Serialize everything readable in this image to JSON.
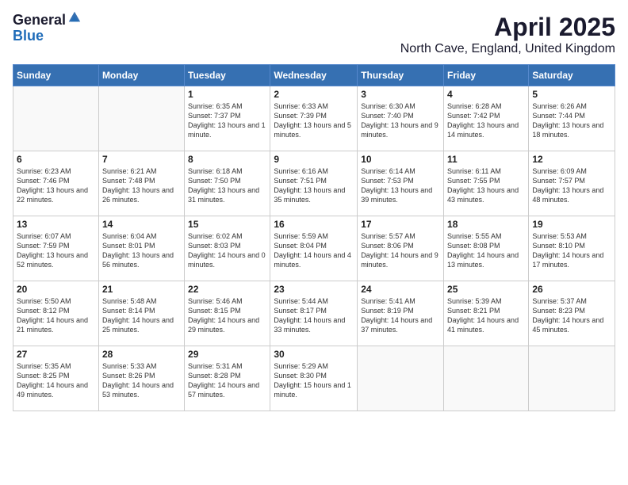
{
  "header": {
    "logo_general": "General",
    "logo_blue": "Blue",
    "title": "April 2025",
    "subtitle": "North Cave, England, United Kingdom"
  },
  "columns": [
    "Sunday",
    "Monday",
    "Tuesday",
    "Wednesday",
    "Thursday",
    "Friday",
    "Saturday"
  ],
  "weeks": [
    [
      {
        "day": "",
        "info": ""
      },
      {
        "day": "",
        "info": ""
      },
      {
        "day": "1",
        "info": "Sunrise: 6:35 AM\nSunset: 7:37 PM\nDaylight: 13 hours and 1 minute."
      },
      {
        "day": "2",
        "info": "Sunrise: 6:33 AM\nSunset: 7:39 PM\nDaylight: 13 hours and 5 minutes."
      },
      {
        "day": "3",
        "info": "Sunrise: 6:30 AM\nSunset: 7:40 PM\nDaylight: 13 hours and 9 minutes."
      },
      {
        "day": "4",
        "info": "Sunrise: 6:28 AM\nSunset: 7:42 PM\nDaylight: 13 hours and 14 minutes."
      },
      {
        "day": "5",
        "info": "Sunrise: 6:26 AM\nSunset: 7:44 PM\nDaylight: 13 hours and 18 minutes."
      }
    ],
    [
      {
        "day": "6",
        "info": "Sunrise: 6:23 AM\nSunset: 7:46 PM\nDaylight: 13 hours and 22 minutes."
      },
      {
        "day": "7",
        "info": "Sunrise: 6:21 AM\nSunset: 7:48 PM\nDaylight: 13 hours and 26 minutes."
      },
      {
        "day": "8",
        "info": "Sunrise: 6:18 AM\nSunset: 7:50 PM\nDaylight: 13 hours and 31 minutes."
      },
      {
        "day": "9",
        "info": "Sunrise: 6:16 AM\nSunset: 7:51 PM\nDaylight: 13 hours and 35 minutes."
      },
      {
        "day": "10",
        "info": "Sunrise: 6:14 AM\nSunset: 7:53 PM\nDaylight: 13 hours and 39 minutes."
      },
      {
        "day": "11",
        "info": "Sunrise: 6:11 AM\nSunset: 7:55 PM\nDaylight: 13 hours and 43 minutes."
      },
      {
        "day": "12",
        "info": "Sunrise: 6:09 AM\nSunset: 7:57 PM\nDaylight: 13 hours and 48 minutes."
      }
    ],
    [
      {
        "day": "13",
        "info": "Sunrise: 6:07 AM\nSunset: 7:59 PM\nDaylight: 13 hours and 52 minutes."
      },
      {
        "day": "14",
        "info": "Sunrise: 6:04 AM\nSunset: 8:01 PM\nDaylight: 13 hours and 56 minutes."
      },
      {
        "day": "15",
        "info": "Sunrise: 6:02 AM\nSunset: 8:03 PM\nDaylight: 14 hours and 0 minutes."
      },
      {
        "day": "16",
        "info": "Sunrise: 5:59 AM\nSunset: 8:04 PM\nDaylight: 14 hours and 4 minutes."
      },
      {
        "day": "17",
        "info": "Sunrise: 5:57 AM\nSunset: 8:06 PM\nDaylight: 14 hours and 9 minutes."
      },
      {
        "day": "18",
        "info": "Sunrise: 5:55 AM\nSunset: 8:08 PM\nDaylight: 14 hours and 13 minutes."
      },
      {
        "day": "19",
        "info": "Sunrise: 5:53 AM\nSunset: 8:10 PM\nDaylight: 14 hours and 17 minutes."
      }
    ],
    [
      {
        "day": "20",
        "info": "Sunrise: 5:50 AM\nSunset: 8:12 PM\nDaylight: 14 hours and 21 minutes."
      },
      {
        "day": "21",
        "info": "Sunrise: 5:48 AM\nSunset: 8:14 PM\nDaylight: 14 hours and 25 minutes."
      },
      {
        "day": "22",
        "info": "Sunrise: 5:46 AM\nSunset: 8:15 PM\nDaylight: 14 hours and 29 minutes."
      },
      {
        "day": "23",
        "info": "Sunrise: 5:44 AM\nSunset: 8:17 PM\nDaylight: 14 hours and 33 minutes."
      },
      {
        "day": "24",
        "info": "Sunrise: 5:41 AM\nSunset: 8:19 PM\nDaylight: 14 hours and 37 minutes."
      },
      {
        "day": "25",
        "info": "Sunrise: 5:39 AM\nSunset: 8:21 PM\nDaylight: 14 hours and 41 minutes."
      },
      {
        "day": "26",
        "info": "Sunrise: 5:37 AM\nSunset: 8:23 PM\nDaylight: 14 hours and 45 minutes."
      }
    ],
    [
      {
        "day": "27",
        "info": "Sunrise: 5:35 AM\nSunset: 8:25 PM\nDaylight: 14 hours and 49 minutes."
      },
      {
        "day": "28",
        "info": "Sunrise: 5:33 AM\nSunset: 8:26 PM\nDaylight: 14 hours and 53 minutes."
      },
      {
        "day": "29",
        "info": "Sunrise: 5:31 AM\nSunset: 8:28 PM\nDaylight: 14 hours and 57 minutes."
      },
      {
        "day": "30",
        "info": "Sunrise: 5:29 AM\nSunset: 8:30 PM\nDaylight: 15 hours and 1 minute."
      },
      {
        "day": "",
        "info": ""
      },
      {
        "day": "",
        "info": ""
      },
      {
        "day": "",
        "info": ""
      }
    ]
  ]
}
